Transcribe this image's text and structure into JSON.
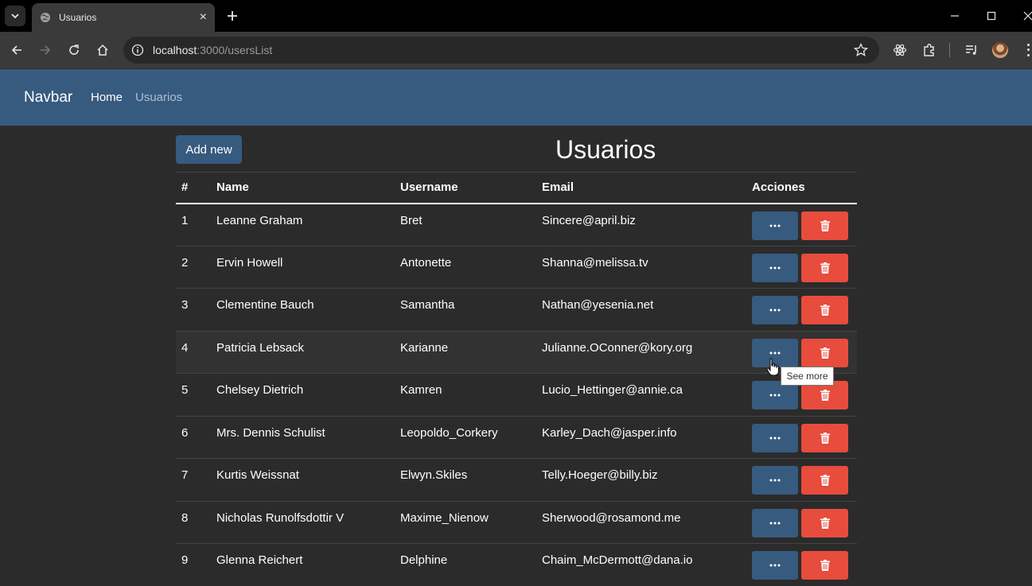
{
  "browser": {
    "tab_title": "Usuarios",
    "tab_close": "×",
    "new_tab": "+",
    "url_host": "localhost",
    "url_rest": ":3000/usersList"
  },
  "navbar": {
    "brand": "Navbar",
    "links": [
      {
        "label": "Home",
        "active": true
      },
      {
        "label": "Usuarios",
        "active": false
      }
    ]
  },
  "page": {
    "title": "Usuarios",
    "add_button": "Add new"
  },
  "table": {
    "headers": [
      "#",
      "Name",
      "Username",
      "Email",
      "Acciones"
    ],
    "rows": [
      {
        "id": "1",
        "name": "Leanne Graham",
        "username": "Bret",
        "email": "Sincere@april.biz"
      },
      {
        "id": "2",
        "name": "Ervin Howell",
        "username": "Antonette",
        "email": "Shanna@melissa.tv"
      },
      {
        "id": "3",
        "name": "Clementine Bauch",
        "username": "Samantha",
        "email": "Nathan@yesenia.net"
      },
      {
        "id": "4",
        "name": "Patricia Lebsack",
        "username": "Karianne",
        "email": "Julianne.OConner@kory.org"
      },
      {
        "id": "5",
        "name": "Chelsey Dietrich",
        "username": "Kamren",
        "email": "Lucio_Hettinger@annie.ca"
      },
      {
        "id": "6",
        "name": "Mrs. Dennis Schulist",
        "username": "Leopoldo_Corkery",
        "email": "Karley_Dach@jasper.info"
      },
      {
        "id": "7",
        "name": "Kurtis Weissnat",
        "username": "Elwyn.Skiles",
        "email": "Telly.Hoeger@billy.biz"
      },
      {
        "id": "8",
        "name": "Nicholas Runolfsdottir V",
        "username": "Maxime_Nienow",
        "email": "Sherwood@rosamond.me"
      },
      {
        "id": "9",
        "name": "Glenna Reichert",
        "username": "Delphine",
        "email": "Chaim_McDermott@dana.io"
      }
    ],
    "more_button_icon": "ellipsis-icon",
    "delete_button_icon": "trash-icon"
  },
  "tooltip": {
    "text": "See more"
  },
  "colors": {
    "primary": "#375a7f",
    "danger": "#e74c3c",
    "background": "#2b2b2b"
  }
}
